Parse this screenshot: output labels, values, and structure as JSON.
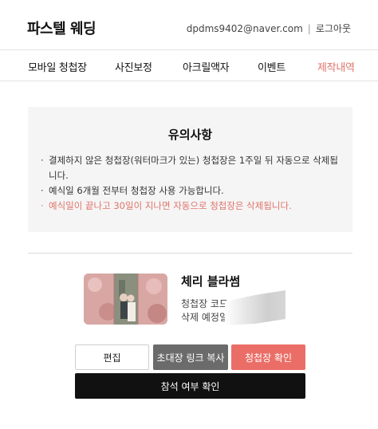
{
  "header": {
    "brand": "파스텔 웨딩",
    "email": "dpdms9402@naver.com",
    "separator": "|",
    "logout": "로그아웃"
  },
  "nav": {
    "items": [
      {
        "label": "모바일 청첩장"
      },
      {
        "label": "사진보정"
      },
      {
        "label": "아크릴액자"
      },
      {
        "label": "이벤트"
      },
      {
        "label": "제작내역"
      }
    ],
    "active": "제작내역"
  },
  "notice": {
    "title": "유의사항",
    "items": [
      "결제하지 않은 청첩장(워터마크가 있는) 청첩장은 1주일 뒤 자동으로 삭제됩니다.",
      "예식일 6개월 전부터 청첩장 사용 가능합니다.",
      "예식일이 끝나고 30일이 지나면 자동으로 청첩장은 삭제됩니다."
    ]
  },
  "card": {
    "title": "체리 블라썸",
    "code_label": "청첩장 코드",
    "delete_label": "삭제 예정일"
  },
  "buttons": {
    "edit": "편집",
    "copy_link": "초대장 링크 복사",
    "check": "청첩장 확인",
    "rsvp": "참석 여부 확인"
  },
  "colors": {
    "accent": "#e0736a",
    "check_button": "#ea6e67",
    "copy_button": "#6b6b6b",
    "rsvp_button": "#111111",
    "notice_bg": "#f5f5f5"
  }
}
